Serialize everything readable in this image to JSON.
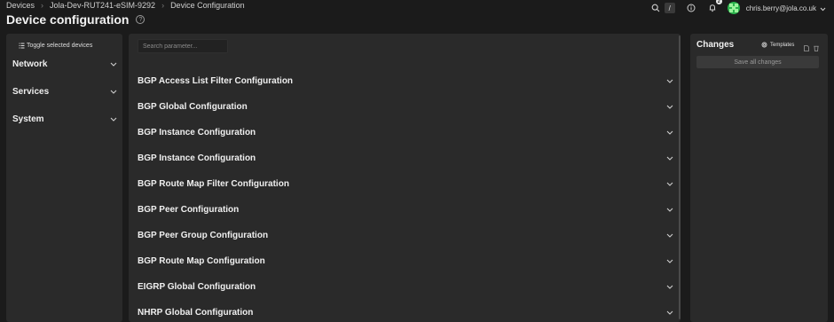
{
  "breadcrumb": [
    "Devices",
    "Jola-Dev-RUT241-eSIM-9292",
    "Device Configuration"
  ],
  "page_title": "Device configuration",
  "top_bar": {
    "shortcut_key": "/",
    "notification_count": "2",
    "user_email": "chris.berry@jola.co.uk"
  },
  "sidebar": {
    "toggle_label": "Toggle selected devices",
    "items": [
      {
        "label": "Network"
      },
      {
        "label": "Services"
      },
      {
        "label": "System"
      }
    ]
  },
  "main": {
    "search_placeholder": "Search parameter...",
    "config_items": [
      "BGP Access List Filter Configuration",
      "BGP Global Configuration",
      "BGP Instance Configuration",
      "BGP Instance Configuration",
      "BGP Route Map Filter Configuration",
      "BGP Peer Configuration",
      "BGP Peer Group Configuration",
      "BGP Route Map Configuration",
      "EIGRP Global Configuration",
      "NHRP Global Configuration"
    ]
  },
  "changes": {
    "title": "Changes",
    "templates_label": "Templates",
    "save_all_label": "Save all changes"
  },
  "colors": {
    "background": "#1b1b1b",
    "panel": "#2a2a2a",
    "avatar": "#2bb24c"
  }
}
